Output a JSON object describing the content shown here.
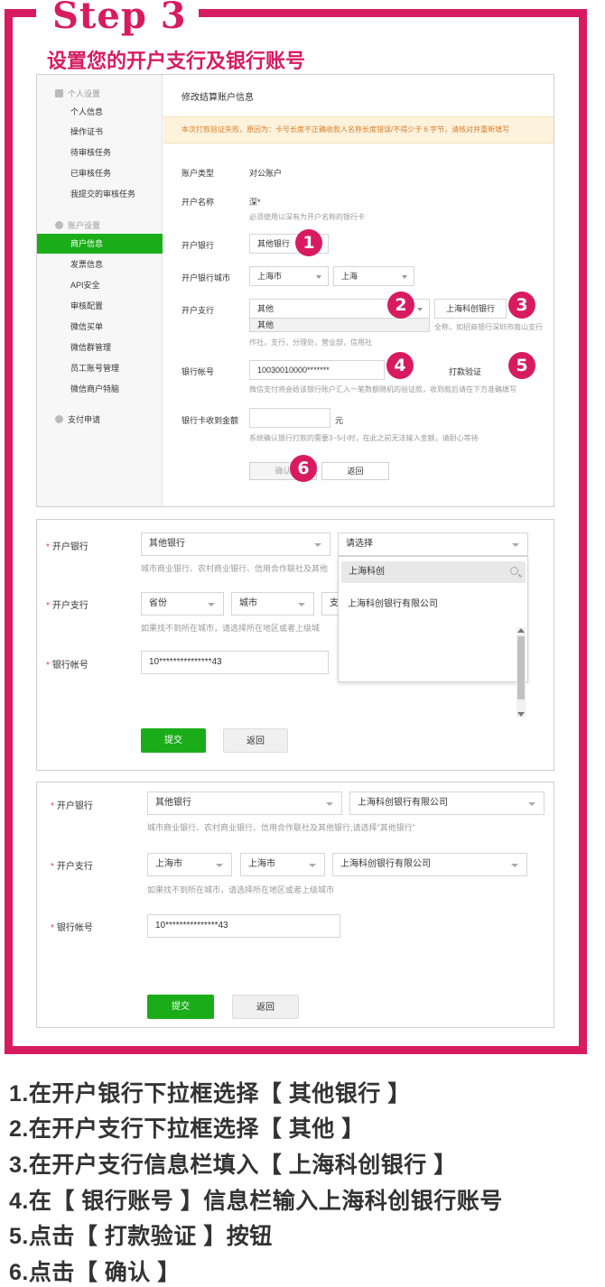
{
  "header": {
    "step": "Step 3",
    "subtitle": "设置您的开户支行及银行账号"
  },
  "screenshot1": {
    "sidebar": {
      "group1": "个人设置",
      "items1": [
        "个人信息",
        "操作证书",
        "待审核任务",
        "已审核任务",
        "我提交的审核任务"
      ],
      "group2": "账户设置",
      "items2": [
        "商户信息",
        "发票信息",
        "API安全",
        "审核配置",
        "微信买单",
        "微信群管理",
        "员工账号管理",
        "微信商户特脑"
      ],
      "group3": "支付申请",
      "active_item": "商户信息"
    },
    "title": "修改结算账户信息",
    "warning": "本次打款验证失败，原因为：卡号长度不正确收款人名称长度错误/不得少于 6 字节，请核对并重新填写",
    "account_type_label": "账户类型",
    "account_type_value": "对公账户",
    "account_name_label": "开户名称",
    "account_name_value": "深*",
    "account_name_hint": "必须使用以深有为开户名称的银行卡",
    "bank_label": "开户银行",
    "bank_value": "其他银行",
    "city_label": "开户银行城市",
    "city_value": "上海市",
    "city_value2": "上海",
    "branch_label": "开户支行",
    "branch_value": "其他",
    "branch_option": "其他",
    "branch_input": "上海科创银行",
    "branch_hint_right": "全称，如招商银行深圳市南山支行",
    "branch_hint": "作社，支行，分理处，营业部，信用社",
    "account_no_label": "银行帐号",
    "account_no_value": "10030010000*******",
    "verify_link": "打款验证",
    "account_hint": "微信支付将会给该银行账户汇入一笔数额随机的验证款，收到款后请在下方准确填写",
    "amount_label": "银行卡收到金额",
    "amount_unit": "元",
    "amount_hint": "系统确认银行打款的需要3~5小时，在此之前无法输入金额，请耐心等待",
    "confirm": "确认",
    "back": "返回",
    "badges": [
      "1",
      "2",
      "3",
      "4",
      "5",
      "6"
    ]
  },
  "screenshot2": {
    "bank_label": "开户银行",
    "bank_value": "其他银行",
    "bank_select2": "请选择",
    "bank_hint": "城市商业银行、农村商业银行、信用合作联社及其他",
    "branch_label": "开户支行",
    "province": "省份",
    "city": "城市",
    "branch_partial": "支",
    "branch_hint": "如果找不到所在城市，请选择所在地区或者上级城",
    "account_label": "银行帐号",
    "account_value": "10***************43",
    "search_value": "上海科创",
    "option": "上海科创银行有限公司",
    "submit": "提交",
    "back": "返回"
  },
  "screenshot3": {
    "bank_label": "开户银行",
    "bank_value": "其他银行",
    "bank_value2": "上海科创银行有限公司",
    "bank_hint": "城市商业银行、农村商业银行、信用合作联社及其他银行,请选择\"其他银行\"",
    "branch_label": "开户支行",
    "province": "上海市",
    "city": "上海市",
    "branch": "上海科创银行有限公司",
    "branch_hint": "如果找不到所在城市，请选择所在地区或者上级城市",
    "account_label": "银行帐号",
    "account_value": "10***************43",
    "submit": "提交",
    "back": "返回"
  },
  "instructions": [
    "1.在开户银行下拉框选择【 其他银行 】",
    "2.在开户支行下拉框选择【 其他 】",
    "3.在开户支行信息栏填入【 上海科创银行 】",
    "4.在【 银行账号 】信息栏输入上海科创银行账号",
    "5.点击【 打款验证 】按钮",
    "6.点击【 确认 】"
  ],
  "colors": {
    "accent": "#d81b60",
    "green": "#1aad19"
  }
}
